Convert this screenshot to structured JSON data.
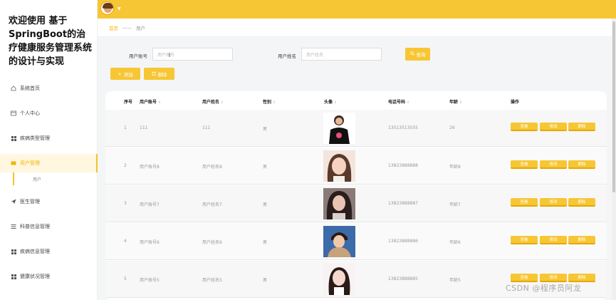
{
  "brand": {
    "title": "欢迎使用 基于SpringBoot的治疗健康服务管理系统的设计与实现"
  },
  "sidebar": {
    "items": [
      {
        "label": "系统首页"
      },
      {
        "label": "个人中心"
      },
      {
        "label": "疾病类型管理"
      },
      {
        "label": "用户管理"
      },
      {
        "label": "医生管理"
      },
      {
        "label": "科普信息管理"
      },
      {
        "label": "疾病信息管理"
      },
      {
        "label": "健康状况管理"
      }
    ],
    "submenu": {
      "label": "用户"
    }
  },
  "breadcrumb": {
    "home": "首页",
    "separator": "——",
    "current": "用户"
  },
  "search": {
    "account_label": "用户账号",
    "account_placeholder": "用户账号",
    "name_label": "用户姓名",
    "name_placeholder": "用户姓名",
    "search_button": "查询"
  },
  "toolbar": {
    "add_label": "添加",
    "delete_label": "删除"
  },
  "table": {
    "headers": [
      "序号",
      "用户账号",
      "用户姓名",
      "性别",
      "头像",
      "电话号码",
      "年龄",
      "操作"
    ],
    "rows": [
      {
        "no": "1",
        "account": "111",
        "name": "111",
        "gender": "男",
        "phone": "13513513555",
        "age": "26"
      },
      {
        "no": "2",
        "account": "用户账号8",
        "name": "用户姓名8",
        "gender": "男",
        "phone": "13823888888",
        "age": "年龄8"
      },
      {
        "no": "3",
        "account": "用户账号7",
        "name": "用户姓名7",
        "gender": "男",
        "phone": "13823888887",
        "age": "年龄7"
      },
      {
        "no": "4",
        "account": "用户账号6",
        "name": "用户姓名6",
        "gender": "男",
        "phone": "13823888886",
        "age": "年龄6"
      },
      {
        "no": "5",
        "account": "用户账号5",
        "name": "用户姓名5",
        "gender": "男",
        "phone": "13823888885",
        "age": "年龄5"
      }
    ],
    "actions": {
      "view": "查看",
      "edit": "修改",
      "delete": "删除"
    }
  },
  "watermark": "CSDN @程序员阿龙",
  "colors": {
    "accent": "#f7c634",
    "accent_dark": "#f5b400"
  }
}
